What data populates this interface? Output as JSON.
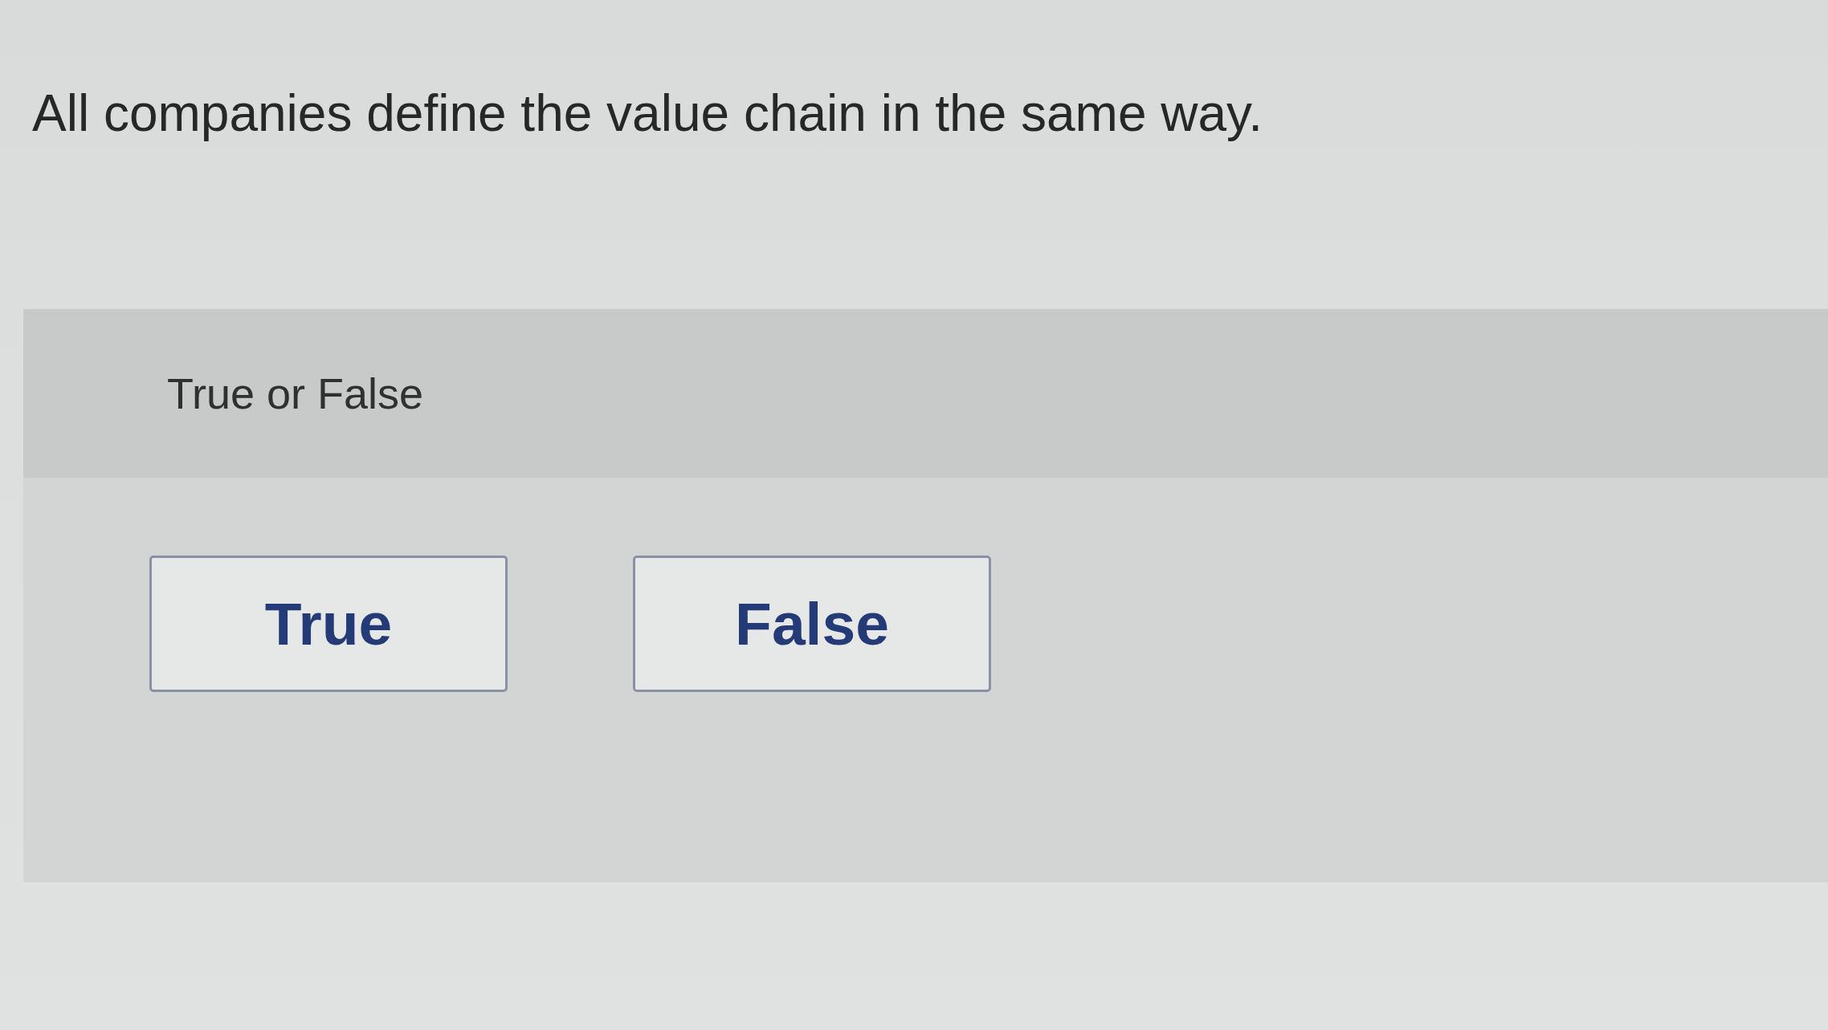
{
  "question": {
    "text": "All companies define the value chain in the same way."
  },
  "answer_panel": {
    "type_label": "True or False",
    "options": [
      {
        "label": "True",
        "selected": false
      },
      {
        "label": "False",
        "selected": false
      }
    ]
  }
}
